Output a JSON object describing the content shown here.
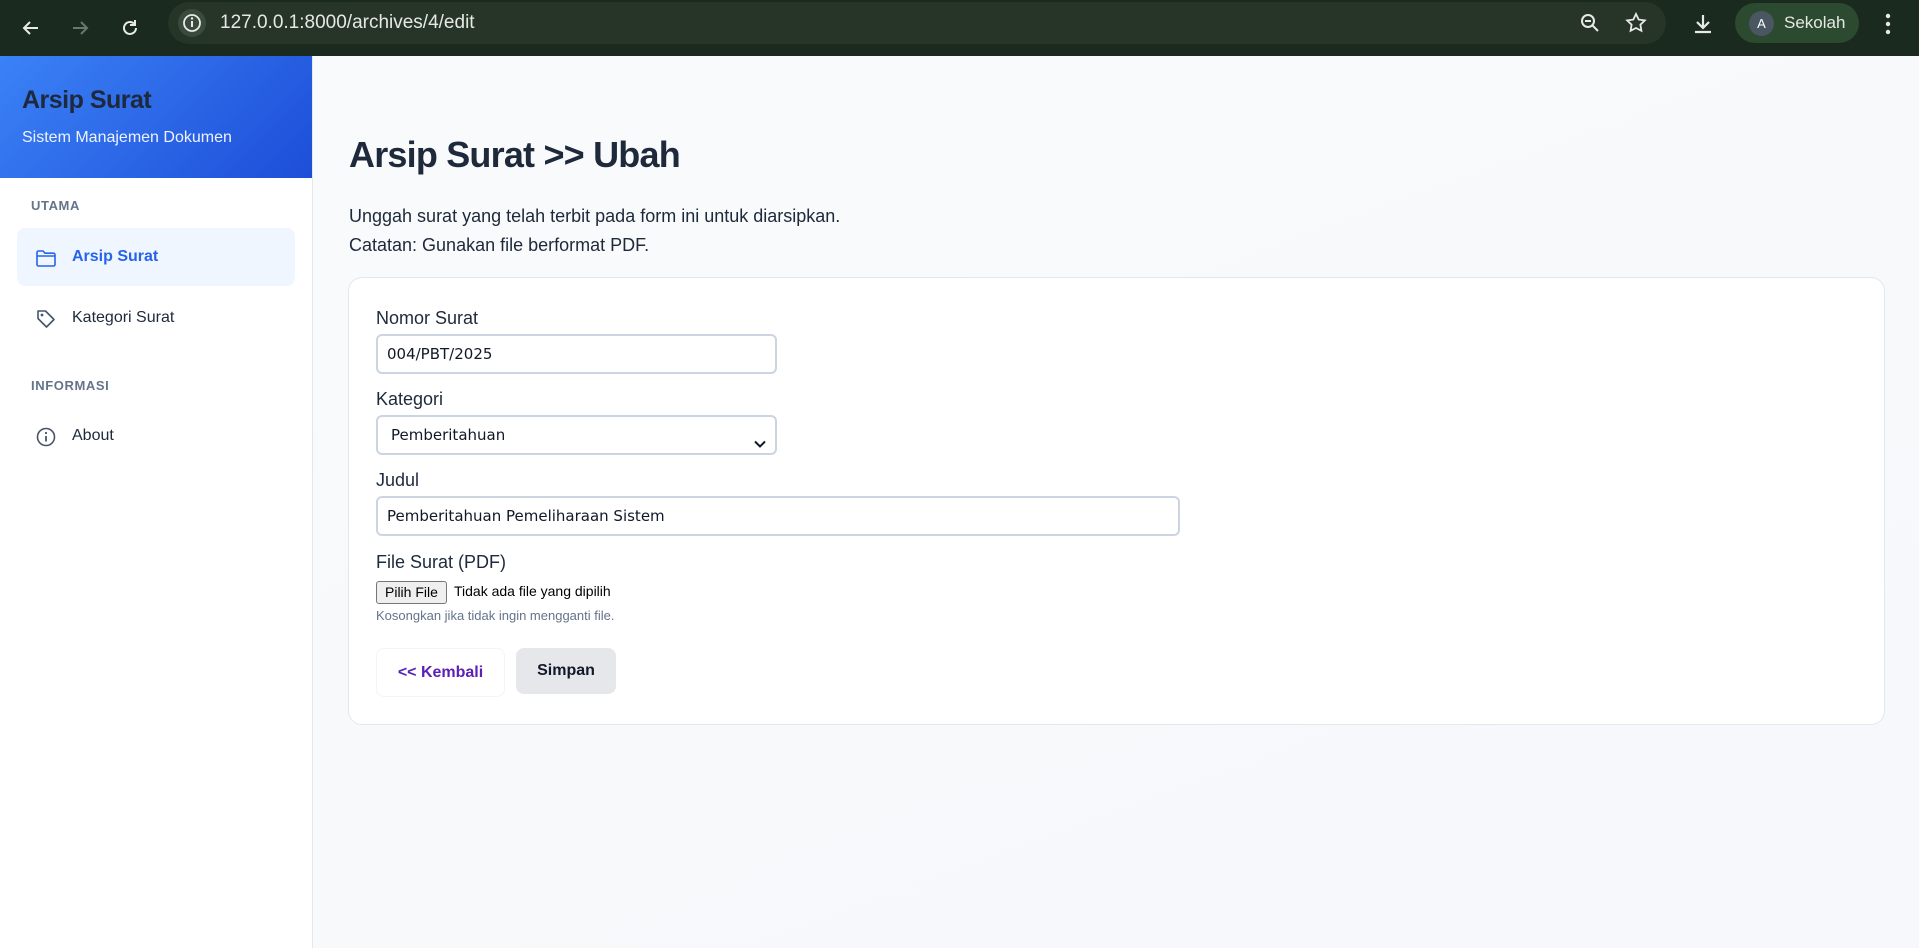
{
  "browser": {
    "url": "127.0.0.1:8000/archives/4/edit",
    "profile_initial": "A",
    "profile_name": "Sekolah",
    "icons": [
      "back-arrow-icon",
      "forward-arrow-icon",
      "reload-icon",
      "site-info-icon",
      "zoom-icon",
      "star-icon",
      "download-icon",
      "more-vert-icon"
    ]
  },
  "sidebar": {
    "title": "Arsip Surat",
    "subtitle": "Sistem Manajemen Dokumen",
    "sections": [
      {
        "label": "UTAMA",
        "items": [
          {
            "label": "Arsip Surat",
            "icon": "folder-icon",
            "active": true
          },
          {
            "label": "Kategori Surat",
            "icon": "tag-icon",
            "active": false
          }
        ]
      },
      {
        "label": "INFORMASI",
        "items": [
          {
            "label": "About",
            "icon": "info-icon",
            "active": false
          }
        ]
      }
    ]
  },
  "main": {
    "title": "Arsip Surat >> Ubah",
    "description_1": "Unggah surat yang telah terbit pada form ini untuk diarsipkan.",
    "description_2": "Catatan: Gunakan file berformat PDF.",
    "form": {
      "nomor_label": "Nomor Surat",
      "nomor_value": "004/PBT/2025",
      "kategori_label": "Kategori",
      "kategori_value": "Pemberitahuan",
      "judul_label": "Judul",
      "judul_value": "Pemberitahuan Pemeliharaan Sistem",
      "file_label": "File Surat (PDF)",
      "file_button": "Pilih File",
      "file_status": "Tidak ada file yang dipilih",
      "file_hint": "Kosongkan jika tidak ingin mengganti file.",
      "back_label": "<< Kembali",
      "save_label": "Simpan"
    }
  },
  "colors": {
    "accent": "#2563eb",
    "brand_gradient_start": "#3b82f6",
    "brand_gradient_end": "#1d4ed8",
    "back_link": "#5b21b6"
  }
}
